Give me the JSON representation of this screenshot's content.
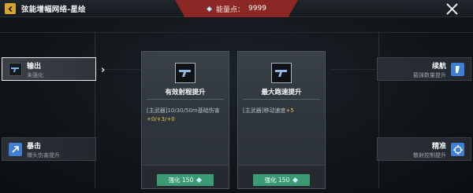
{
  "header": {
    "title": "弦能增幅网络-星绘",
    "energy_label": "能量点：",
    "energy_value": "9999"
  },
  "left_cards": [
    {
      "name": "输出",
      "desc": "未强化",
      "icon": "pistol-icon",
      "active": true
    },
    {
      "name": "暴击",
      "desc": "爆头伤害提升",
      "icon": "arrow-up-right-icon",
      "active": false
    }
  ],
  "right_cards": [
    {
      "name": "续航",
      "desc": "载弹数量提升",
      "icon": "magazine-icon"
    },
    {
      "name": "精准",
      "desc": "散射控制提升",
      "icon": "crosshair-icon"
    }
  ],
  "panels": [
    {
      "title": "有效射程提升",
      "desc_prefix": "[主武器]10/30/50m基础伤害",
      "desc_highlight": "+0/+3/+0",
      "button_label": "强化 150",
      "icon": "pistol-icon"
    },
    {
      "title": "最大跑速提升",
      "desc_prefix": "[主武器]移动速度",
      "desc_highlight": "+5",
      "button_label": "强化 150",
      "icon": "pistol-icon"
    }
  ],
  "colors": {
    "accent_gold": "#d7a431",
    "energy_bar": "#8b2724",
    "enhance_button": "#3c9a73",
    "highlight_text": "#e6c84f",
    "skill_icon_blue": "#3f7fd6"
  }
}
